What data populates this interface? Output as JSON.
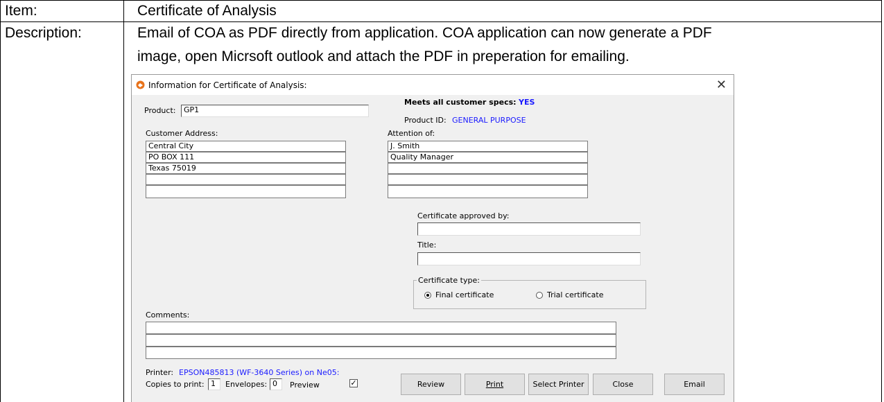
{
  "doc": {
    "item_label": "Item:",
    "item_value": "Certificate of Analysis",
    "description_label": "Description:",
    "description_line1": "Email of COA as PDF directly from application.  COA application can now generate a PDF",
    "description_line2": "image, open Micrsoft outlook and attach the PDF in preperation for emailing."
  },
  "dialog": {
    "title": "Information for Certificate of Analysis:",
    "close_icon": "close-icon",
    "product_label": "Product:",
    "product_value": "GP1",
    "meets_specs_label": "Meets all customer specs:",
    "meets_specs_value": "YES",
    "product_id_label": "Product ID:",
    "product_id_value": "GENERAL PURPOSE",
    "customer_address_label": "Customer Address:",
    "customer_address_lines": [
      "Central City",
      "PO BOX 111",
      "Texas 75019",
      "",
      ""
    ],
    "attention_label": "Attention of:",
    "attention_lines": [
      "J. Smith",
      "Quality Manager",
      "",
      "",
      ""
    ],
    "approved_by_label": "Certificate approved by:",
    "approved_by_value": "",
    "title_label": "Title:",
    "title_value": "",
    "certificate_type_label": "Certificate type:",
    "cert_type_options": [
      {
        "label": "Final certificate",
        "selected": true
      },
      {
        "label": "Trial certificate",
        "selected": false
      }
    ],
    "comments_label": "Comments:",
    "comments_lines": [
      "",
      "",
      ""
    ],
    "printer_label": "Printer:",
    "printer_value": "EPSON485813 (WF-3640 Series) on Ne05:",
    "copies_label": "Copies to print:",
    "copies_value": "1",
    "envelopes_label": "Envelopes:",
    "envelopes_value": "0",
    "preview_label": "Preview",
    "preview_checked": true,
    "buttons": {
      "review": "Review",
      "print": "Print",
      "select_printer": "Select Printer",
      "close": "Close",
      "email": "Email"
    },
    "link_color": "#1a1aff",
    "app_icon": "certificate-app-icon"
  }
}
